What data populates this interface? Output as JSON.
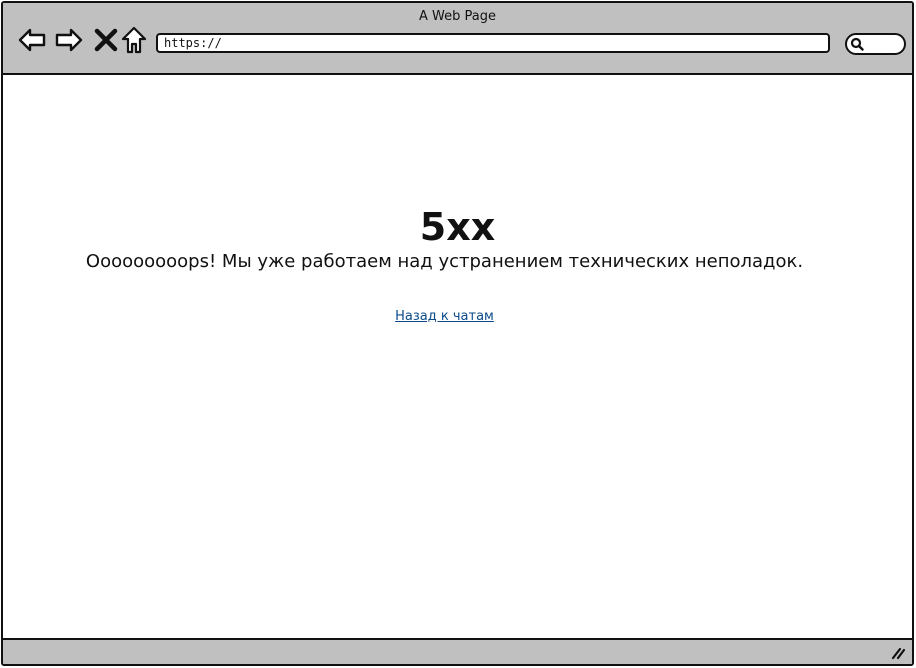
{
  "window": {
    "title": "A Web Page"
  },
  "toolbar": {
    "address_value": "https://",
    "icons": [
      "back-arrow-icon",
      "forward-arrow-icon",
      "close-icon",
      "home-icon",
      "search-icon"
    ]
  },
  "page": {
    "error_code": "5xx",
    "error_message": "Ooooooooops! Мы уже работаем над устранением технических неполадок.",
    "back_link_label": "Назад к чатам"
  },
  "colors": {
    "chrome": "#c0c0c0",
    "link": "#0a4a8a",
    "text": "#111111"
  }
}
